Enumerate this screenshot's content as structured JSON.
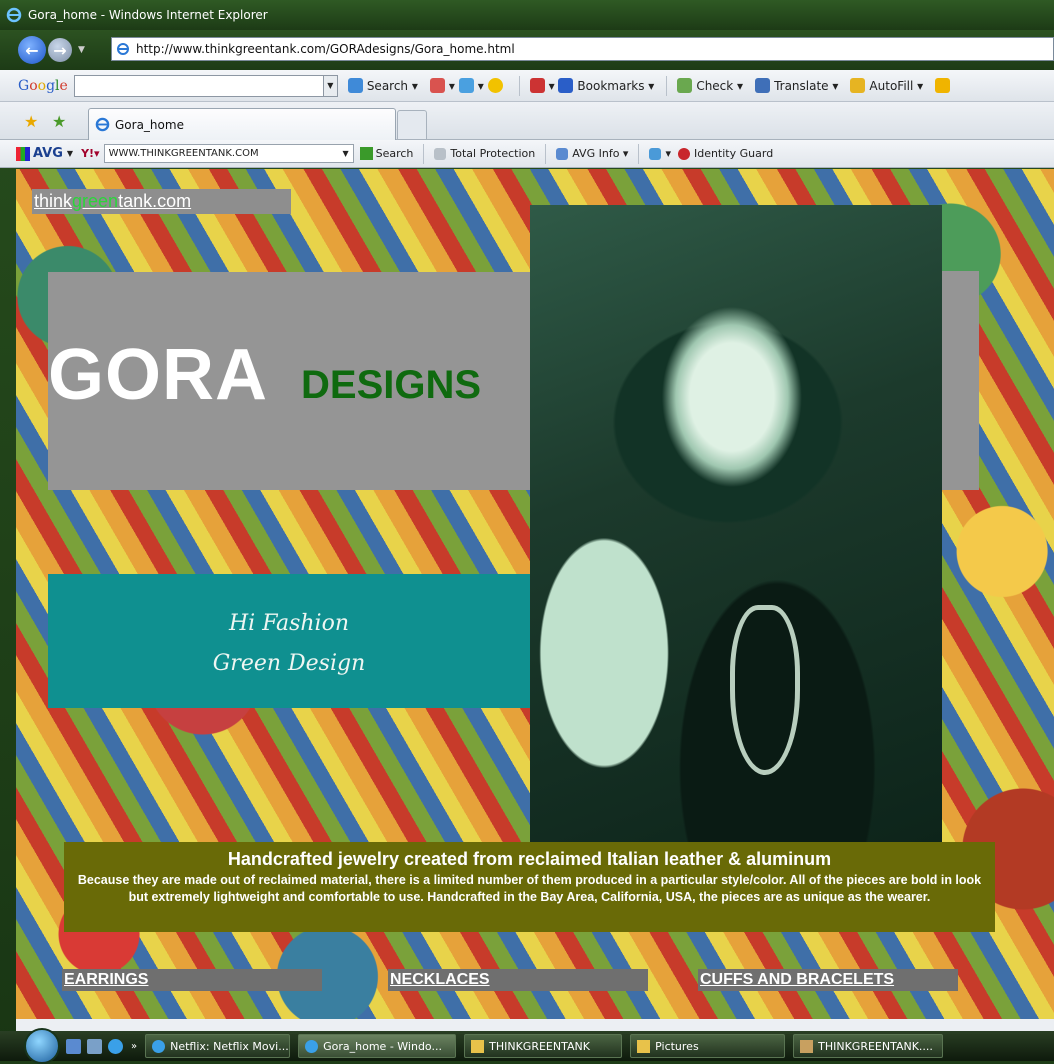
{
  "window": {
    "title": "Gora_home - Windows Internet Explorer"
  },
  "address": {
    "url": "http://www.thinkgreentank.com/GORAdesigns/Gora_home.html"
  },
  "google_toolbar": {
    "logo": "Google",
    "items": [
      "Search",
      "Bookmarks",
      "Check",
      "Translate",
      "AutoFill"
    ]
  },
  "tabs": [
    {
      "label": "Gora_home"
    }
  ],
  "avg_toolbar": {
    "logo": "AVG",
    "search_value": "WWW.THINKGREENTANK.COM",
    "search_label": "Search",
    "items": [
      "Total Protection",
      "AVG Info",
      "Identity Guard"
    ]
  },
  "page": {
    "logo": {
      "prefix": "think",
      "green": "green",
      "suffix": "tank.com"
    },
    "brand": {
      "main": "GORA",
      "sub": "DESIGNS"
    },
    "tagline": [
      "Hi Fashion",
      "Green Design"
    ],
    "description": {
      "heading": "Handcrafted jewelry created from reclaimed Italian leather & aluminum",
      "body": "Because they are made out of reclaimed material, there is a limited number of them produced in a particular style/color. All of the pieces are bold in look but extremely lightweight and comfortable to use. Handcrafted in the Bay Area, California, USA, the pieces are as unique as the wearer."
    },
    "nav": [
      {
        "label": "EARRINGS"
      },
      {
        "label": "NECKLACES"
      },
      {
        "label": "CUFFS AND BRACELETS"
      }
    ]
  },
  "taskbar": {
    "tasks": [
      {
        "label": "Netflix: Netflix Movi..."
      },
      {
        "label": "Gora_home - Windo..."
      },
      {
        "label": "THINKGREENTANK"
      },
      {
        "label": "Pictures"
      },
      {
        "label": "THINKGREENTANK...."
      }
    ]
  },
  "colors": {
    "logo_green": "#2bd53a",
    "designs_green": "#0f6a0f",
    "teal_box": "#0f9090",
    "olive_box": "#696a07",
    "gray_box": "#959595"
  }
}
